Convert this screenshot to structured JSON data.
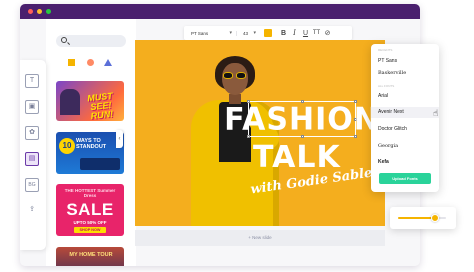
{
  "window": {
    "traffic_lights": [
      "#ff5f57",
      "#febc2e",
      "#28c840"
    ],
    "titlebar_color": "#4a1f6e"
  },
  "rail": {
    "items": [
      {
        "icon": "text-icon",
        "glyph": "T"
      },
      {
        "icon": "image-icon",
        "glyph": "▣"
      },
      {
        "icon": "elements-icon",
        "glyph": "✿"
      },
      {
        "icon": "templates-icon",
        "glyph": "▤",
        "active": true
      },
      {
        "icon": "background-icon",
        "glyph": "BG"
      },
      {
        "icon": "upload-icon",
        "glyph": "⇪"
      }
    ]
  },
  "templates": [
    {
      "title": "MUST SEE! RUN!"
    },
    {
      "number": "10",
      "title": "WAYS TO STANDOUT"
    },
    {
      "top": "THE HOTTEST Summer Dress",
      "title": "SALE",
      "offer": "UPTO 50% OFF",
      "cta": "SHOP NOW"
    },
    {
      "title": "MY HOME TOUR"
    }
  ],
  "toolbar": {
    "font": "PT Sans",
    "size": "43",
    "color": "#f5b400",
    "bold": "B",
    "italic": "I",
    "underline": "U",
    "case": "TT",
    "link": "⊘"
  },
  "canvas": {
    "headline_1": "FASHION",
    "headline_2": "TALK",
    "byline": "with Godie Sable",
    "background": "#f4ae1e"
  },
  "new_slide": "+ New slide",
  "font_dropdown": {
    "section_recent": "RECENTS",
    "section_all": "ALL FONTS",
    "fonts": [
      "PT Sans",
      "Baskerville",
      "Arial",
      "Avenir Next",
      "Doctor Glitch",
      "Georgia",
      "Kefa"
    ],
    "selected": "Avenir Next",
    "upload_label": "Upload Fonts"
  },
  "slider": {
    "value": 0.78
  }
}
